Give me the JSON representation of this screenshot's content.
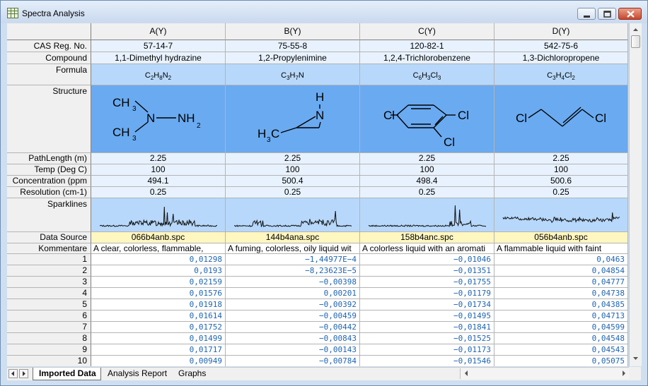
{
  "window": {
    "title": "Spectra Analysis"
  },
  "columns": [
    "A(Y)",
    "B(Y)",
    "C(Y)",
    "D(Y)"
  ],
  "meta_rows": [
    {
      "label": "CAS Reg. No.",
      "values": [
        "57-14-7",
        "75-55-8",
        "120-82-1",
        "542-75-6"
      ]
    },
    {
      "label": "Compound",
      "values": [
        "1,1-Dimethyl hydrazine",
        "1,2-Propylenimine",
        "1,2,4-Trichlorobenzene",
        "1,3-Dichloropropene"
      ]
    }
  ],
  "formula": {
    "label": "Formula",
    "values": [
      [
        {
          "t": "C"
        },
        {
          "t": "2",
          "s": 1
        },
        {
          "t": "H"
        },
        {
          "t": "8",
          "s": 1
        },
        {
          "t": "N"
        },
        {
          "t": "2",
          "s": 1
        }
      ],
      [
        {
          "t": "C"
        },
        {
          "t": "3",
          "s": 1
        },
        {
          "t": "H"
        },
        {
          "t": "7",
          "s": 1
        },
        {
          "t": "N"
        }
      ],
      [
        {
          "t": "C"
        },
        {
          "t": "6",
          "s": 1
        },
        {
          "t": "H"
        },
        {
          "t": "3",
          "s": 1
        },
        {
          "t": "Cl"
        },
        {
          "t": "3",
          "s": 1
        }
      ],
      [
        {
          "t": "C"
        },
        {
          "t": "3",
          "s": 1
        },
        {
          "t": "H"
        },
        {
          "t": "4",
          "s": 1
        },
        {
          "t": "Cl"
        },
        {
          "t": "2",
          "s": 1
        }
      ]
    ]
  },
  "structure": {
    "label": "Structure",
    "atoms": {
      "a": [
        "CH",
        "3",
        "N",
        "NH",
        "2",
        "CH",
        "3"
      ],
      "b": [
        "H",
        "N",
        "H",
        "3",
        "C"
      ],
      "c": [
        "Cl",
        "Cl",
        "Cl"
      ],
      "d": [
        "Cl",
        "Cl"
      ]
    }
  },
  "param_rows": [
    {
      "label": "PathLength (m)",
      "values": [
        "2.25",
        "2.25",
        "2.25",
        "2.25"
      ]
    },
    {
      "label": "Temp (Deg C)",
      "values": [
        "100",
        "100",
        "100",
        "100"
      ]
    },
    {
      "label": "Concentration (ppm",
      "values": [
        "494.1",
        "500.4",
        "498.4",
        "500.6"
      ]
    },
    {
      "label": "Resolution (cm-1)",
      "values": [
        "0.25",
        "0.25",
        "0.25",
        "0.25"
      ]
    }
  ],
  "sparklines": {
    "label": "Sparklines"
  },
  "data_source": {
    "label": "Data Source",
    "values": [
      "066b4anb.spc",
      "144b4ana.spc",
      "158b4anc.spc",
      "056b4anb.spc"
    ]
  },
  "comments": {
    "label": "Kommentare",
    "values": [
      "A clear, colorless, flammable,",
      "A fuming, colorless, oily liquid wit",
      "A colorless liquid with an aromati",
      "A flammable liquid with faint"
    ]
  },
  "data_rows": [
    {
      "index": "1",
      "values": [
        "0,01298",
        "−1,44977E−4",
        "−0,01046",
        "0,0463"
      ]
    },
    {
      "index": "2",
      "values": [
        "0,0193",
        "−8,23623E−5",
        "−0,01351",
        "0,04854"
      ]
    },
    {
      "index": "3",
      "values": [
        "0,02159",
        "−0,00398",
        "−0,01755",
        "0,04777"
      ]
    },
    {
      "index": "4",
      "values": [
        "0,01576",
        "0,00201",
        "−0,01179",
        "0,04738"
      ]
    },
    {
      "index": "5",
      "values": [
        "0,01918",
        "−0,00392",
        "−0,01734",
        "0,04385"
      ]
    },
    {
      "index": "6",
      "values": [
        "0,01614",
        "−0,00459",
        "−0,01495",
        "0,04713"
      ]
    },
    {
      "index": "7",
      "values": [
        "0,01752",
        "−0,00442",
        "−0,01841",
        "0,04599"
      ]
    },
    {
      "index": "8",
      "values": [
        "0,01499",
        "−0,00843",
        "−0,01525",
        "0,04548"
      ]
    },
    {
      "index": "9",
      "values": [
        "0,01717",
        "−0,00143",
        "−0,01173",
        "0,04543"
      ]
    },
    {
      "index": "10",
      "values": [
        "0,00949",
        "−0,00784",
        "−0,01546",
        "0,05075"
      ]
    }
  ],
  "tabs": [
    "Imported Data",
    "Analysis Report",
    "Graphs"
  ],
  "colors": {
    "structure_bg": "#6aaaf0",
    "sparkline_bg": "#b7d8fa",
    "meta_bg": "#e8f2fe",
    "datasource_bg": "#fff6c0",
    "number_text": "#1e64b4"
  }
}
